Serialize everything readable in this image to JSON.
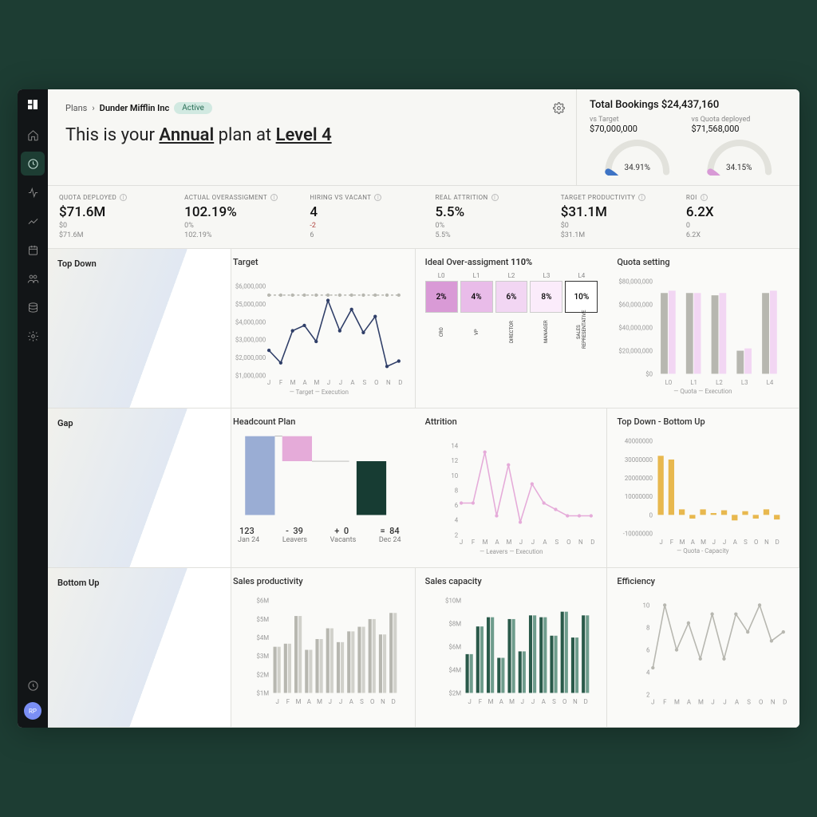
{
  "breadcrumb": {
    "root": "Plans",
    "current": "Dunder Mifflin Inc",
    "badge": "Active"
  },
  "plan_title": {
    "prefix": "This is your ",
    "type": "Annual",
    "middle": " plan at ",
    "level": "Level 4"
  },
  "total_bookings": {
    "label": "Total Bookings",
    "value": "$24,437,160",
    "target": {
      "label": "vs Target",
      "value": "$70,000,000",
      "pct": "34.91%",
      "pct_num": 34.91,
      "color": "#3e74c5"
    },
    "quota": {
      "label": "vs Quota deployed",
      "value": "$71,568,000",
      "pct": "34.15%",
      "pct_num": 34.15,
      "color": "#d89ad6"
    }
  },
  "metrics": [
    {
      "label": "QUOTA DEPLOYED",
      "value": "$71.6M",
      "sub1": "$0",
      "sub2": "$71.6M"
    },
    {
      "label": "ACTUAL OVERASSIGMENT",
      "value": "102.19%",
      "sub1": "0%",
      "sub2": "102.19%"
    },
    {
      "label": "HIRING VS VACANT",
      "value": "4",
      "sub1": "-2",
      "sub1_red": true,
      "sub2": "6"
    },
    {
      "label": "REAL ATTRITION",
      "value": "5.5%",
      "sub1": "0%",
      "sub2": "5.5%"
    },
    {
      "label": "TARGET PRODUCTIVITY",
      "value": "$31.1M",
      "sub1": "$0",
      "sub2": "$31.1M"
    },
    {
      "label": "ROI",
      "value": "6.2X",
      "sub1": "0",
      "sub2": "6.2X"
    }
  ],
  "rows": [
    "Top Down",
    "Gap",
    "Bottom Up"
  ],
  "months": [
    "J",
    "F",
    "M",
    "A",
    "M",
    "J",
    "J",
    "A",
    "S",
    "O",
    "N",
    "D"
  ],
  "chart_data": [
    {
      "id": "target",
      "title": "Target",
      "type": "line",
      "ylabel": "",
      "x": [
        "J",
        "F",
        "M",
        "A",
        "M",
        "J",
        "J",
        "A",
        "S",
        "O",
        "N",
        "D"
      ],
      "yticks": [
        "$1,000,000",
        "$2,000,000",
        "$3,000,000",
        "$4,000,000",
        "$5,000,000",
        "$6,000,000"
      ],
      "ylim": [
        1000000,
        6000000
      ],
      "series": [
        {
          "name": "Target",
          "values": [
            5500000,
            5500000,
            5500000,
            5500000,
            5500000,
            5500000,
            5500000,
            5500000,
            5500000,
            5500000,
            5500000,
            5500000
          ],
          "style": "dashed",
          "color": "#b7b7b0"
        },
        {
          "name": "Execution",
          "values": [
            2400000,
            1700000,
            3500000,
            3800000,
            2900000,
            5200000,
            3500000,
            4700000,
            3400000,
            4300000,
            1500000,
            1800000
          ],
          "style": "solid",
          "color": "#2f3e68"
        }
      ],
      "legend": [
        "Target",
        "Execution"
      ]
    },
    {
      "id": "overassign",
      "title_prefix": "Ideal Over-assigment ",
      "title_bold": "110%",
      "type": "table",
      "levels": [
        "L0",
        "L1",
        "L2",
        "L3",
        "L4"
      ],
      "roles": [
        "CRO",
        "VP",
        "DIRECTOR",
        "MANAGER",
        "SALES REPRESENTATIVE"
      ],
      "values": [
        "2%",
        "4%",
        "6%",
        "8%",
        "10%"
      ],
      "colors": [
        "#d99ad6",
        "#e9bce9",
        "#f2d6f3",
        "#fbecfb",
        "#ffffff"
      ],
      "highlight_index": 4
    },
    {
      "id": "quota_setting",
      "title": "Quota setting",
      "type": "bar",
      "x": [
        "L0",
        "L1",
        "L2",
        "L3",
        "L4"
      ],
      "yticks": [
        "$0",
        "$20,000,000",
        "$40,000,000",
        "$60,000,000",
        "$80,000,000"
      ],
      "ylim": [
        0,
        80000000
      ],
      "series": [
        {
          "name": "Quota",
          "values": [
            70000000,
            70000000,
            68000000,
            20000000,
            70000000
          ],
          "color": "#b7b7b0"
        },
        {
          "name": "Execution",
          "values": [
            72000000,
            70000000,
            70000000,
            22000000,
            72000000
          ],
          "color": "#f2d6f3"
        }
      ],
      "legend": [
        "Quota",
        "Execution"
      ]
    },
    {
      "id": "headcount",
      "title": "Headcount Plan",
      "type": "waterfall",
      "items": [
        {
          "label": "Jan 24",
          "value": 123,
          "color": "#9aadd4"
        },
        {
          "label": "Leavers",
          "value": 39,
          "op": "-",
          "color": "#e5abd9"
        },
        {
          "label": "Vacants",
          "value": 0,
          "op": "+",
          "color": "#eee"
        },
        {
          "label": "Dec 24",
          "value": 84,
          "op": "=",
          "color": "#173c33"
        }
      ]
    },
    {
      "id": "attrition",
      "title": "Attrition",
      "type": "line",
      "x": [
        "J",
        "F",
        "M",
        "A",
        "M",
        "J",
        "J",
        "A",
        "S",
        "O",
        "N",
        "D"
      ],
      "yticks": [
        "2",
        "4",
        "6",
        "8",
        "10",
        "12",
        "14"
      ],
      "ylim": [
        0,
        14
      ],
      "series": [
        {
          "name": "Leavers",
          "values": [
            5,
            5,
            13,
            3,
            11,
            2,
            8,
            5,
            4,
            3,
            3,
            3
          ],
          "color": "#e5abd9"
        },
        {
          "name": "Execution",
          "values": [
            5,
            5,
            13,
            3,
            11,
            2,
            8,
            5,
            4,
            3,
            3,
            3
          ],
          "color": "#bbb",
          "style": "hidden"
        }
      ],
      "legend": [
        "Leavers",
        "Execution"
      ]
    },
    {
      "id": "topdown_bottomup",
      "title": "Top Down - Bottom Up",
      "type": "bar",
      "x": [
        "J",
        "F",
        "M",
        "A",
        "M",
        "J",
        "J",
        "A",
        "S",
        "O",
        "N",
        "D"
      ],
      "yticks": [
        "-10000000",
        "0",
        "10000000",
        "20000000",
        "30000000",
        "40000000"
      ],
      "ylim": [
        -10000000,
        40000000
      ],
      "series": [
        {
          "name": "Quota - Capacity",
          "values": [
            32000000,
            30000000,
            3000000,
            -2000000,
            3000000,
            1000000,
            2500000,
            -3000000,
            2000000,
            -2000000,
            3000000,
            -2500000
          ],
          "color": "#e8b84e"
        }
      ],
      "legend": [
        "Quota - Capacity"
      ]
    },
    {
      "id": "sales_productivity",
      "title": "Sales productivity",
      "type": "bar",
      "x": [
        "J",
        "F",
        "M",
        "A",
        "M",
        "J",
        "J",
        "A",
        "S",
        "O",
        "N",
        "D"
      ],
      "yticks": [
        "$1M",
        "$2M",
        "$3M",
        "$4M",
        "$5M",
        "$6M"
      ],
      "ylim": [
        0,
        6000000
      ],
      "series": [
        {
          "name": "A",
          "values": [
            3000000,
            3200000,
            5000000,
            2800000,
            3500000,
            4200000,
            3300000,
            4000000,
            4300000,
            4800000,
            3800000,
            5200000
          ],
          "color": "#b7b7b0"
        },
        {
          "name": "B",
          "values": [
            3000000,
            3200000,
            5000000,
            2800000,
            3500000,
            4200000,
            3300000,
            4000000,
            4300000,
            4800000,
            3800000,
            5200000
          ],
          "color": "#d1d1cb"
        }
      ]
    },
    {
      "id": "sales_capacity",
      "title": "Sales capacity",
      "type": "bar",
      "x": [
        "J",
        "F",
        "M",
        "A",
        "M",
        "J",
        "J",
        "A",
        "S",
        "O",
        "N",
        "D"
      ],
      "yticks": [
        "$2M",
        "$4M",
        "$6M",
        "$8M",
        "$10M"
      ],
      "ylim": [
        0,
        10000000
      ],
      "series": [
        {
          "name": "A",
          "values": [
            4200000,
            7200000,
            8200000,
            3800000,
            8000000,
            4500000,
            8400000,
            8200000,
            6200000,
            8800000,
            6000000,
            8400000
          ],
          "color": "#2a5a4a"
        },
        {
          "name": "B",
          "values": [
            4200000,
            7200000,
            8200000,
            3800000,
            8000000,
            4500000,
            8400000,
            8200000,
            6200000,
            8800000,
            6000000,
            8400000
          ],
          "color": "#6e9c8c"
        }
      ]
    },
    {
      "id": "efficiency",
      "title": "Efficiency",
      "type": "line",
      "x": [
        "J",
        "F",
        "M",
        "A",
        "M",
        "J",
        "J",
        "A",
        "S",
        "O",
        "N",
        "D"
      ],
      "yticks": [
        "2",
        "4",
        "6",
        "8",
        "10"
      ],
      "ylim": [
        0,
        10
      ],
      "single": {
        "values": [
          3,
          10,
          5,
          8,
          4,
          9,
          4,
          9,
          7,
          10,
          6,
          7
        ],
        "color": "#b7b7b0"
      }
    }
  ]
}
